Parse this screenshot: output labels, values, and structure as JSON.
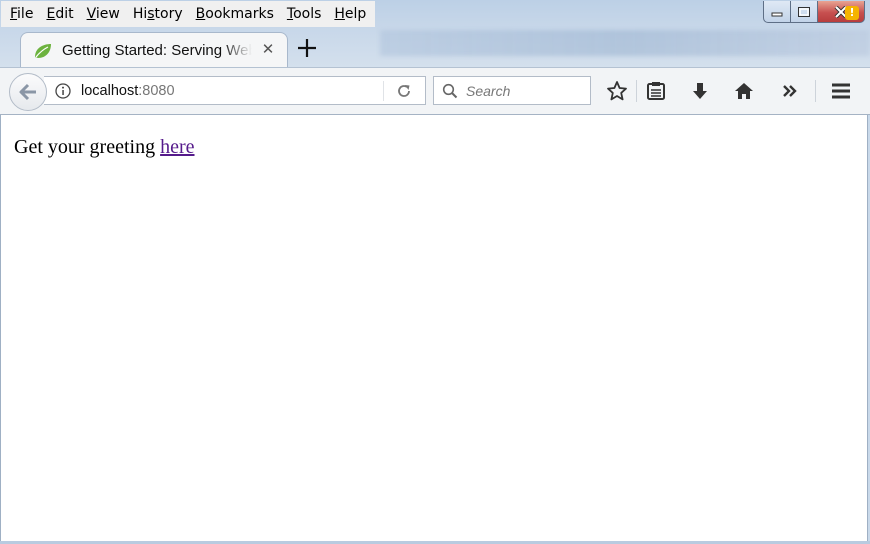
{
  "menu": {
    "items": [
      {
        "accel": "F",
        "rest": "ile"
      },
      {
        "accel": "E",
        "rest": "dit"
      },
      {
        "accel": "V",
        "rest": "iew"
      },
      {
        "pre": "Hi",
        "accel": "s",
        "rest": "tory"
      },
      {
        "accel": "B",
        "rest": "ookmarks"
      },
      {
        "accel": "T",
        "rest": "ools"
      },
      {
        "accel": "H",
        "rest": "elp"
      }
    ]
  },
  "tab": {
    "title": "Getting Started: Serving Web Content",
    "close_glyph": "✕"
  },
  "navbar": {
    "url_host": "localhost",
    "url_port": ":8080",
    "search_placeholder": "Search"
  },
  "menu_badge": "!",
  "page": {
    "text": "Get your greeting ",
    "link": "here"
  },
  "colors": {
    "link_visited": "#551a8b",
    "badge": "#f5b400",
    "close_button": "#c75050"
  }
}
